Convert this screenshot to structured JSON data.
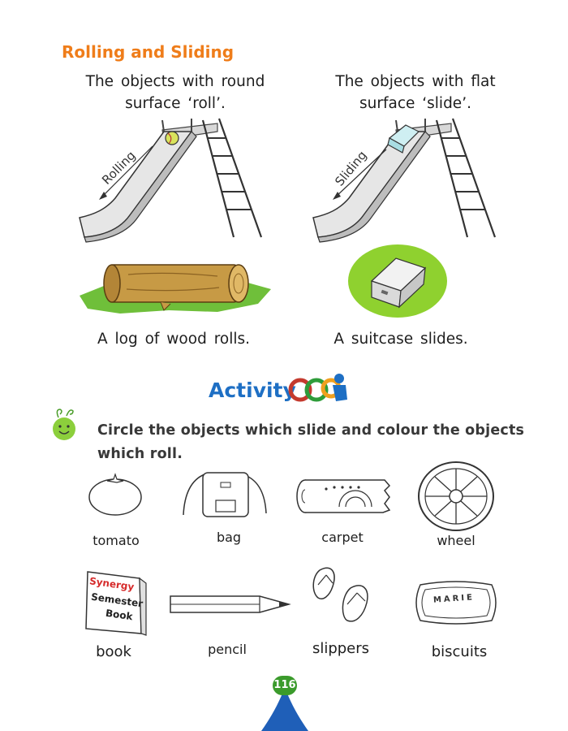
{
  "section": {
    "heading": "Rolling and Sliding"
  },
  "left_panel": {
    "caption_line1": "The objects with round",
    "caption_line2": "surface ‘roll’.",
    "slide_label": "Rolling",
    "bottom_caption": "A log of wood rolls."
  },
  "right_panel": {
    "caption_line1": "The objects with flat",
    "caption_line2": "surface ‘slide’.",
    "slide_label": "Sliding",
    "bottom_caption": "A suitcase slides."
  },
  "activity": {
    "title": "Activity",
    "instruction_line1": "Circle the objects which slide and colour the objects",
    "instruction_line2": "which roll."
  },
  "items": {
    "tomato": "tomato",
    "bag": "bag",
    "carpet": "carpet",
    "wheel": "wheel",
    "book": "book",
    "pencil": "pencil",
    "slippers": "slippers",
    "biscuits": "biscuits"
  },
  "book_cover": {
    "line1": "Synergy",
    "line2": "Semester",
    "line3": "Book"
  },
  "biscuit_text": "MARIE",
  "page_number": "116",
  "colors": {
    "heading": "#ef7d1a",
    "activity_blue": "#1e6fc4",
    "page_green": "#3b9b2c",
    "page_blue": "#1f5fb8",
    "suitcase_green": "#8fd12f"
  }
}
